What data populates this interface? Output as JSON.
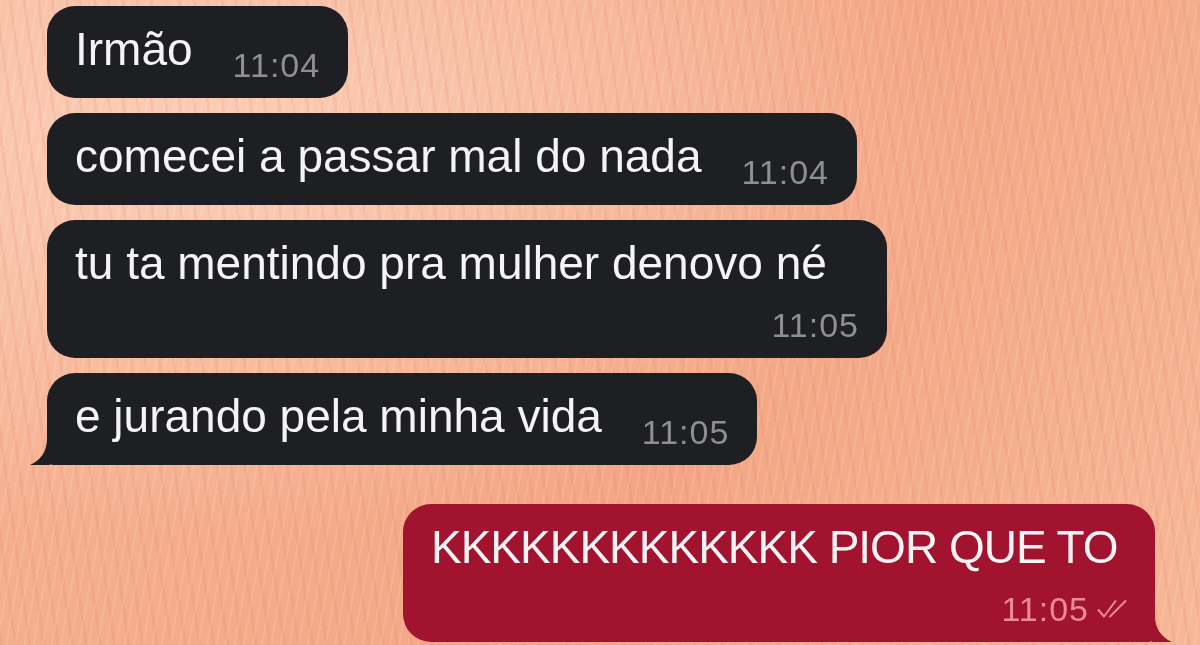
{
  "messages": [
    {
      "kind": "incoming",
      "text": "Irmão",
      "time": "11:04",
      "tail": false
    },
    {
      "kind": "incoming",
      "text": "comecei a passar mal do nada",
      "time": "11:04",
      "tail": false
    },
    {
      "kind": "incoming",
      "text": "tu ta mentindo pra mulher denovo né",
      "time": "11:05",
      "tail": false
    },
    {
      "kind": "incoming",
      "text": "e jurando pela minha vida",
      "time": "11:05",
      "tail": true
    },
    {
      "kind": "outgoing",
      "text": "KKKKKKKKKKKKK PIOR QUE TO",
      "time": "11:05",
      "tail": true,
      "read": true
    }
  ]
}
